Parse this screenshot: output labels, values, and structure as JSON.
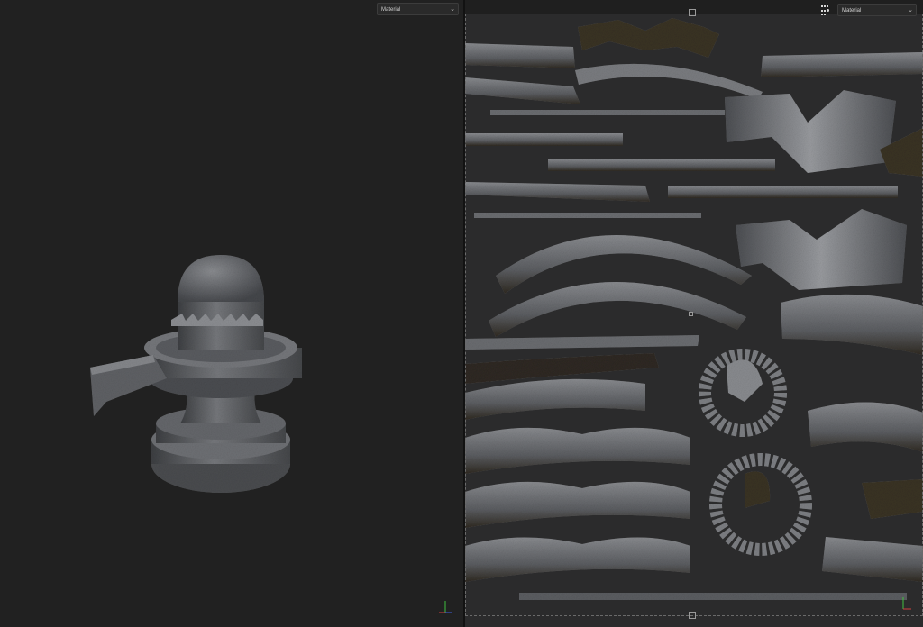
{
  "viewport_3d": {
    "channel_dropdown": {
      "value": "Material"
    }
  },
  "viewport_2d": {
    "channel_dropdown": {
      "value": "Material"
    },
    "layout_icon": "layout-grid-icon"
  },
  "axes_gizmo": {
    "x_color": "#d04040",
    "y_color": "#40c040",
    "z_color": "#4060e0"
  },
  "colors": {
    "viewport_bg": "#212121",
    "uv_bg": "#2b2b2c",
    "stone": "#6b6d70",
    "moss": "#3a3325"
  }
}
